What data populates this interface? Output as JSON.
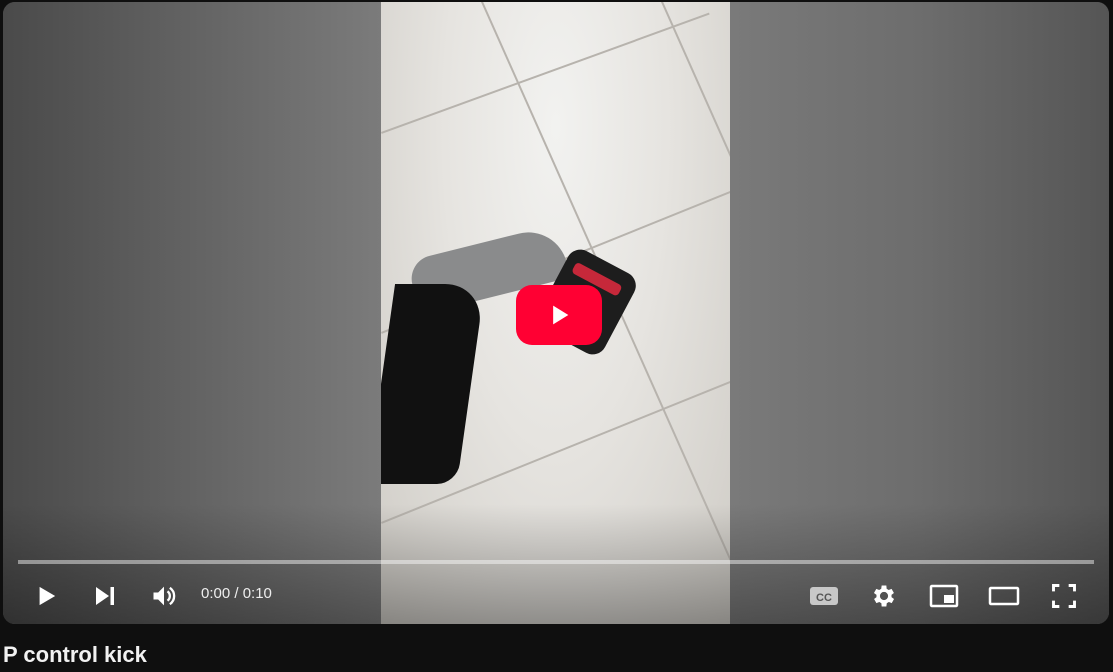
{
  "player": {
    "time_display": "0:00 / 0:10",
    "progress": 0,
    "controls": {
      "play": "play-icon",
      "next": "next-icon",
      "volume": "volume-icon",
      "captions": "closed-captions-icon",
      "settings": "gear-icon",
      "miniplayer": "miniplayer-icon",
      "theater": "theater-mode-icon",
      "fullscreen": "fullscreen-icon"
    },
    "big_play_color": "#ff0033"
  },
  "video": {
    "title": "P control kick"
  }
}
